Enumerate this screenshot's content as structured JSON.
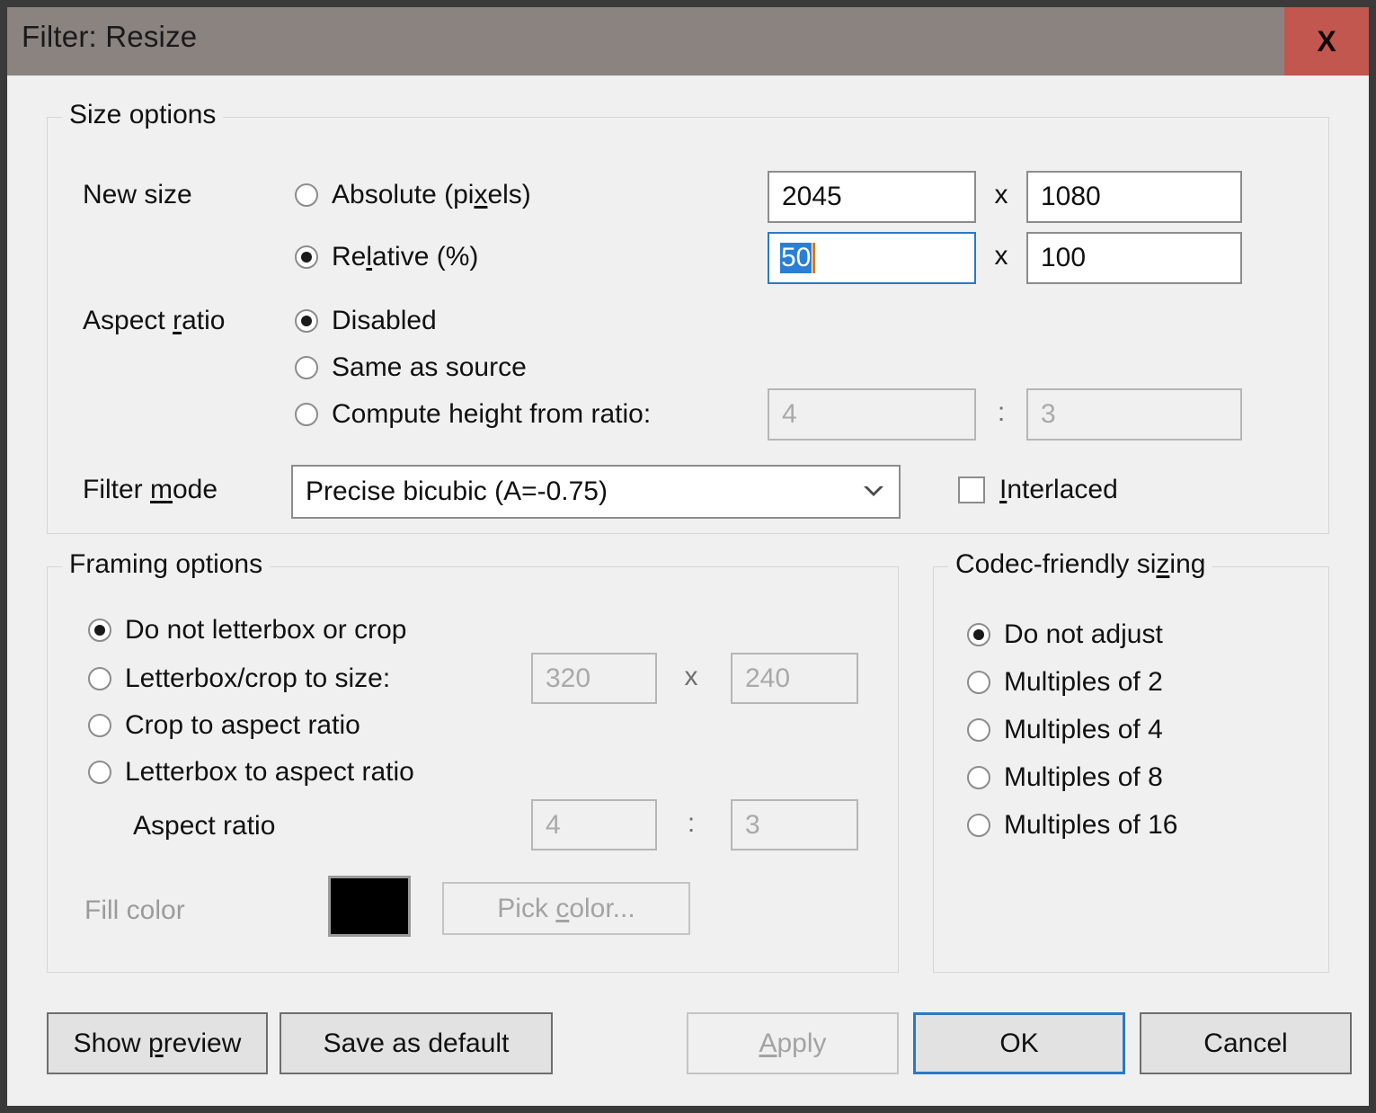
{
  "window": {
    "title": "Filter: Resize",
    "close_label": "X",
    "accent_focus": "#2b79c2",
    "titlebar_color": "#8a8380",
    "close_color": "#c1574f",
    "dialog_bg": "#f0f0f0"
  },
  "size_options": {
    "group_title": "Size options",
    "new_size_label": "New size",
    "absolute": {
      "label_pre": "Absolute (pi",
      "label_accel": "x",
      "label_post": "els)",
      "selected": false
    },
    "relative": {
      "label_pre": "Re",
      "label_accel": "l",
      "label_post": "ative (%)",
      "selected": true
    },
    "absolute_width": "2045",
    "absolute_height": "1080",
    "relative_width": "50",
    "relative_width_selected": true,
    "relative_height": "100",
    "x_separator": "x",
    "aspect_ratio_label_pre": "Aspect ",
    "aspect_ratio_label_accel": "r",
    "aspect_ratio_label_post": "atio",
    "aspect_disabled": {
      "label": "Disabled",
      "selected": true
    },
    "aspect_same_as_source": {
      "label": "Same as source",
      "selected": false
    },
    "aspect_compute": {
      "label_pre": "Compute hei",
      "label_accel": "g",
      "label_post": "ht from ratio:",
      "selected": false
    },
    "compute_ratio_w": "4",
    "compute_ratio_h": "3",
    "ratio_separator": ":",
    "filter_mode_label_pre": "Filter ",
    "filter_mode_label_accel": "m",
    "filter_mode_label_post": "ode",
    "filter_mode_value": "Precise bicubic (A=-0.75)",
    "interlaced": {
      "label_accel": "I",
      "label_post": "nterlaced",
      "checked": false
    }
  },
  "framing_options": {
    "group_title": "Framing options",
    "do_not_letterbox": {
      "label": "Do not letterbox or crop",
      "selected": true
    },
    "letterbox_crop_to_size": {
      "label": "Letterbox/crop to size:",
      "selected": false
    },
    "crop_to_aspect": {
      "label": "Crop to aspect ratio",
      "selected": false
    },
    "letterbox_to_aspect": {
      "label": "Letterbox to aspect ratio",
      "selected": false
    },
    "letterbox_width": "320",
    "letterbox_height": "240",
    "x_separator": "x",
    "aspect_ratio_label": "Aspect ratio",
    "aspect_w": "4",
    "aspect_h": "3",
    "ratio_separator": ":",
    "fill_color_label": "Fill color",
    "fill_color_value": "#000000",
    "pick_color": {
      "label_pre": "Pick ",
      "label_accel": "c",
      "label_post": "olor..."
    }
  },
  "codec_sizing": {
    "group_title_pre": "Codec-friendly si",
    "group_title_accel": "z",
    "group_title_post": "ing",
    "options": [
      {
        "label": "Do not adjust",
        "selected": true
      },
      {
        "label": "Multiples of 2",
        "selected": false
      },
      {
        "label": "Multiples of 4",
        "selected": false
      },
      {
        "label": "Multiples of 8",
        "selected": false
      },
      {
        "label": "Multiples of 16",
        "selected": false
      }
    ]
  },
  "buttons": {
    "show_preview": {
      "pre": "Show ",
      "accel": "p",
      "post": "review"
    },
    "save_as_default": {
      "label": "Save as default"
    },
    "apply": {
      "accel": "A",
      "post": "pply",
      "disabled": true
    },
    "ok": {
      "label": "OK",
      "is_default": true
    },
    "cancel": {
      "label": "Cancel"
    }
  }
}
